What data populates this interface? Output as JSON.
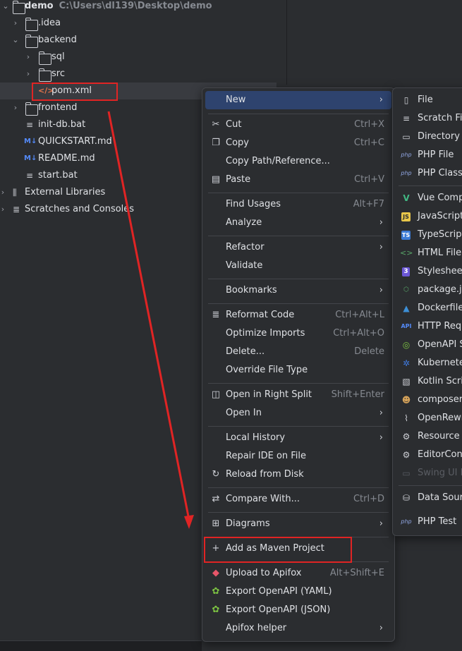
{
  "project_tree": {
    "root": {
      "name": "demo",
      "path": "C:\\Users\\dl139\\Desktop\\demo"
    },
    "items": [
      {
        "label": "demo"
      },
      {
        "label": ".idea"
      },
      {
        "label": "backend"
      },
      {
        "label": "sql"
      },
      {
        "label": "src"
      },
      {
        "label": "pom.xml"
      },
      {
        "label": "frontend"
      },
      {
        "label": "init-db.bat"
      },
      {
        "label": "QUICKSTART.md"
      },
      {
        "label": "README.md"
      },
      {
        "label": "start.bat"
      },
      {
        "label": "External Libraries"
      },
      {
        "label": "Scratches and Consoles"
      }
    ]
  },
  "context_menu": {
    "items": [
      {
        "label": "New",
        "shortcut": ""
      },
      {
        "label": "Cut",
        "shortcut": "Ctrl+X"
      },
      {
        "label": "Copy",
        "shortcut": "Ctrl+C"
      },
      {
        "label": "Copy Path/Reference...",
        "shortcut": ""
      },
      {
        "label": "Paste",
        "shortcut": "Ctrl+V"
      },
      {
        "label": "Find Usages",
        "shortcut": "Alt+F7"
      },
      {
        "label": "Analyze",
        "shortcut": ""
      },
      {
        "label": "Refactor",
        "shortcut": ""
      },
      {
        "label": "Validate",
        "shortcut": ""
      },
      {
        "label": "Bookmarks",
        "shortcut": ""
      },
      {
        "label": "Reformat Code",
        "shortcut": "Ctrl+Alt+L"
      },
      {
        "label": "Optimize Imports",
        "shortcut": "Ctrl+Alt+O"
      },
      {
        "label": "Delete...",
        "shortcut": "Delete"
      },
      {
        "label": "Override File Type",
        "shortcut": ""
      },
      {
        "label": "Open in Right Split",
        "shortcut": "Shift+Enter"
      },
      {
        "label": "Open In",
        "shortcut": ""
      },
      {
        "label": "Local History",
        "shortcut": ""
      },
      {
        "label": "Repair IDE on File",
        "shortcut": ""
      },
      {
        "label": "Reload from Disk",
        "shortcut": ""
      },
      {
        "label": "Compare With...",
        "shortcut": "Ctrl+D"
      },
      {
        "label": "Diagrams",
        "shortcut": ""
      },
      {
        "label": "Add as Maven Project",
        "shortcut": ""
      },
      {
        "label": "Upload to Apifox",
        "shortcut": "Alt+Shift+E"
      },
      {
        "label": "Export OpenAPI (YAML)",
        "shortcut": ""
      },
      {
        "label": "Export OpenAPI (JSON)",
        "shortcut": ""
      },
      {
        "label": "Apifox helper",
        "shortcut": ""
      }
    ]
  },
  "new_submenu": {
    "items": [
      {
        "label": "File",
        "icon": "P"
      },
      {
        "label": "Scratch File",
        "icon": "P"
      },
      {
        "label": "Directory",
        "icon": "P"
      },
      {
        "label": "PHP File",
        "icon": "php"
      },
      {
        "label": "PHP Class",
        "icon": "php"
      },
      {
        "label": "Vue Comp",
        "icon": "V"
      },
      {
        "label": "JavaScript",
        "icon": "JS"
      },
      {
        "label": "TypeScript",
        "icon": "TS"
      },
      {
        "label": "HTML File",
        "icon": "<>"
      },
      {
        "label": "Stylesheet",
        "icon": "3"
      },
      {
        "label": "package.js",
        "icon": "JS"
      },
      {
        "label": "Dockerfile",
        "icon": "D"
      },
      {
        "label": "HTTP Requ",
        "icon": "API"
      },
      {
        "label": "OpenAPI S",
        "icon": "O"
      },
      {
        "label": "Kubernete",
        "icon": "K"
      },
      {
        "label": "Kotlin Scrip",
        "icon": "K"
      },
      {
        "label": "composer.j",
        "icon": "C"
      },
      {
        "label": "OpenRewri",
        "icon": "O"
      },
      {
        "label": "Resource B",
        "icon": "gear"
      },
      {
        "label": "EditorConf",
        "icon": "gear"
      },
      {
        "label": "Swing UI D",
        "icon": "window"
      },
      {
        "label": "Data Sourc",
        "icon": "db"
      },
      {
        "label": "PHP Test",
        "icon": "php"
      }
    ]
  },
  "colors": {
    "highlight": "#2e436e",
    "annotation": "#e02424",
    "background": "#2b2d30"
  }
}
